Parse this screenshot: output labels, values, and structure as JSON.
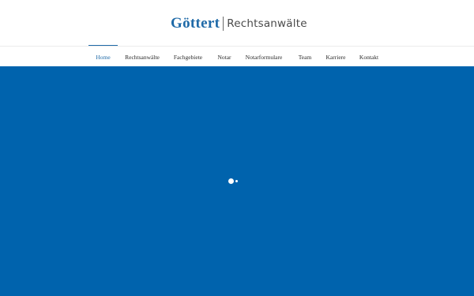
{
  "brand": {
    "name_strong": "Göttert",
    "name_light": "Rechtsanwälte"
  },
  "nav": {
    "items": [
      {
        "label": "Home",
        "active": true
      },
      {
        "label": "Rechtsanwälte",
        "active": false
      },
      {
        "label": "Fachgebiete",
        "active": false
      },
      {
        "label": "Notar",
        "active": false
      },
      {
        "label": "Notarformulare",
        "active": false
      },
      {
        "label": "Team",
        "active": false
      },
      {
        "label": "Karriere",
        "active": false
      },
      {
        "label": "Kontakt",
        "active": false
      }
    ]
  },
  "hero": {
    "background_color": "#0063ad",
    "slider_dots": 2,
    "active_dot": 1
  },
  "colors": {
    "accent": "#1f6aa8"
  }
}
